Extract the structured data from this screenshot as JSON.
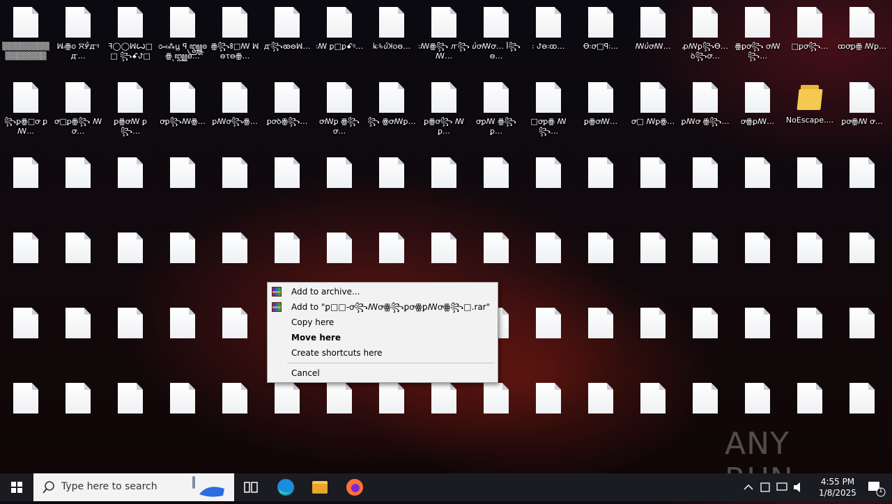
{
  "desktop": {
    "icons": [
      {
        "label": "▒▒▒▒▒▒▒▒ ▒▒▒▒▒▒▒",
        "type": "file"
      },
      {
        "label": "ꟽ៲ꙮ꧐ ꯆ꯸ꯥꙣꝰꙣ…",
        "type": "file"
      },
      {
        "label": "ꟻ◯◯ꟽꙌ□□ ꧂ꗃꚠ□ꛯ…",
        "type": "file"
      },
      {
        "label": "ꗢ⁂ꚏ ꟼ꧃ꙩꙮ꧃ꙩ…",
        "type": "file"
      },
      {
        "label": "ꙮ꧂ꗚ□ꟿ ꟽꙫꚍꙫꙮ…",
        "type": "file"
      },
      {
        "label": "ꙣ꧂ꙭꙫꟽ…",
        "type": "file"
      },
      {
        "label": "꧇ꟿ ꝑ□ꝑꗃꝰ…",
        "type": "file"
      },
      {
        "label": "ꝃ꧇ꚥꞿꞰ꧐ꙫ…",
        "type": "file"
      },
      {
        "label": "꧇ꟿꙮ꧂ ꙥ꧂ꟿ…",
        "type": "file"
      },
      {
        "label": "ꞿꝍꟿꝍ… ꟾ꧂ꙫ…",
        "type": "file"
      },
      {
        "label": "꧇ ꚠꙫ꧇ꚙ…",
        "type": "file"
      },
      {
        "label": "Ꝋ꧇ꝍ□ꟼ꧇…",
        "type": "file"
      },
      {
        "label": "ꟿꞿꝍꟿ… ",
        "type": "file"
      },
      {
        "label": "ꝓꟿꝑ꧂Ꝋ… ꝺ꧂ꝍ…",
        "type": "file"
      },
      {
        "label": "ꙮꝑꝍ꧂ ꝍꟿ꧂…",
        "type": "file"
      },
      {
        "label": "□ꝑꝍ꧂… ",
        "type": "file"
      },
      {
        "label": "ꝏꝍꝑꙮ ꟿꝑ…",
        "type": "file"
      },
      {
        "label": "꧂ꝑꙮ□ꝍ ꝑꟿ…",
        "type": "file"
      },
      {
        "label": "ꝍ□ꝑꙮ꧂ ꟿꝍ…",
        "type": "file"
      },
      {
        "label": "ꝑꙮꝍꟿ ꝑ꧂…",
        "type": "file"
      },
      {
        "label": "ꝍꝑ꧂ꟿꙮ…",
        "type": "file"
      },
      {
        "label": "ꝑꟿꝍ꧂ꙮ…",
        "type": "file"
      },
      {
        "label": "ꝑꝍꝺꙮ꧂…",
        "type": "file"
      },
      {
        "label": "ꝍꟿꝑ ꙮ꧂ꝍ…",
        "type": "file"
      },
      {
        "label": "꧂ ꙮꝍꟿꝑ…",
        "type": "file"
      },
      {
        "label": "ꝑꙮꝍ꧂ ꟿꝑ…",
        "type": "file"
      },
      {
        "label": "ꝍꝑꟿ ꙮ꧂ꝑ…",
        "type": "file"
      },
      {
        "label": "□ꝍꝑꙮ ꟿ꧂…",
        "type": "file"
      },
      {
        "label": "ꝑꙮꝍꟿ…",
        "type": "file"
      },
      {
        "label": "ꝍ□ ꟿꝑꙮ…",
        "type": "file"
      },
      {
        "label": "ꝑꟿꝍ ꙮ꧂…",
        "type": "file"
      },
      {
        "label": "ꝍꙮꝑꟿ…",
        "type": "file"
      },
      {
        "label": "NoEscape....",
        "type": "folder"
      },
      {
        "label": "ꝑꝍꙮꟿ ꝍ…",
        "type": "file"
      }
    ],
    "more_icon_rows": 4
  },
  "context_menu": {
    "items": [
      {
        "label": "Add to archive...",
        "icon": "winrar-icon",
        "bold": false
      },
      {
        "label": "Add to \"ꝑ□□-ꝍ꧂ꟿꝍꙮ꧂ꝑꝍꙮꝑꟿꝍꙮ꧂□.rar\"",
        "icon": "winrar-icon",
        "bold": false
      },
      {
        "label": "Copy here",
        "icon": "",
        "bold": false
      },
      {
        "label": "Move here",
        "icon": "",
        "bold": true
      },
      {
        "label": "Create shortcuts here",
        "icon": "",
        "bold": false
      },
      {
        "label": "Cancel",
        "icon": "",
        "bold": false
      }
    ]
  },
  "taskbar": {
    "search_placeholder": "Type here to search",
    "time": "4:55 PM",
    "date": "1/8/2025",
    "notification_count": "1"
  },
  "watermark": "ANY RUN"
}
